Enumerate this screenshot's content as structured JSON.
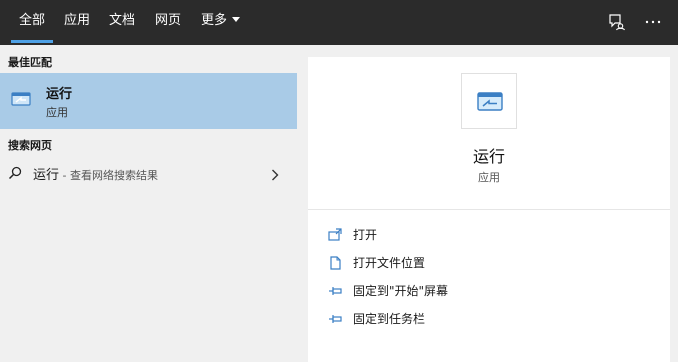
{
  "topbar": {
    "tabs": [
      {
        "label": "全部",
        "active": true
      },
      {
        "label": "应用"
      },
      {
        "label": "文档"
      },
      {
        "label": "网页"
      },
      {
        "label": "更多"
      }
    ],
    "icons": [
      "feedback-icon",
      "more-options-icon"
    ]
  },
  "left": {
    "best_match_label": "最佳匹配",
    "best_match": {
      "title": "运行",
      "subtitle": "应用",
      "icon": "run-app-icon"
    },
    "web_section_label": "搜索网页",
    "web_result": {
      "query": "运行",
      "suffix": " - 查看网络搜索结果",
      "icon": "search-icon"
    }
  },
  "detail": {
    "title": "运行",
    "subtitle": "应用",
    "icon": "run-app-icon",
    "actions": [
      {
        "label": "打开",
        "icon": "open-icon"
      },
      {
        "label": "打开文件位置",
        "icon": "file-location-icon"
      },
      {
        "label": "固定到\"开始\"屏幕",
        "icon": "pin-icon"
      },
      {
        "label": "固定到任务栏",
        "icon": "pin-icon"
      }
    ]
  },
  "colors": {
    "topbar_bg": "#2b2b2b",
    "selected_bg": "#a9cbe7",
    "accent": "#4ea1e6",
    "icon_blue": "#3b7fc4"
  }
}
